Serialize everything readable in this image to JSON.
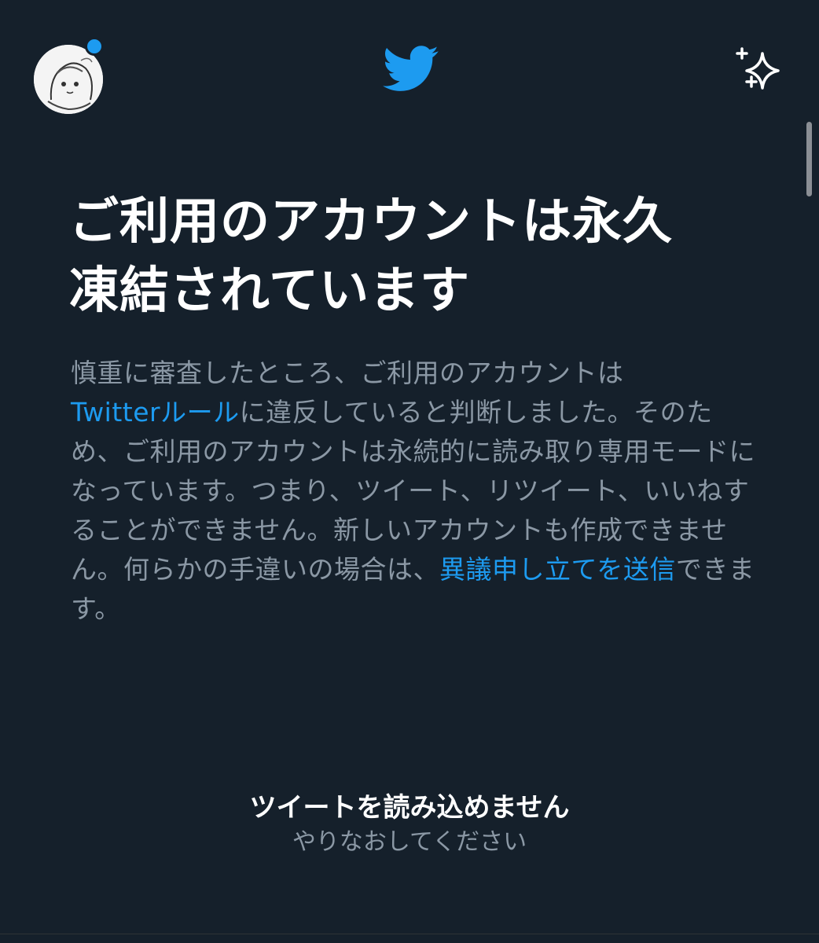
{
  "header": {
    "avatar_icon": "profile-avatar",
    "logo_icon": "twitter-bird-icon",
    "sparkle_icon": "sparkle-icon",
    "accent_color": "#1d9bf0"
  },
  "notice": {
    "headline_line1": "ご利用のアカウントは永久",
    "headline_line2": "凍結されています",
    "body_part1": "慎重に審査したところ、ご利用のアカウントは",
    "rules_link": "Twitterルール",
    "body_part2": "に違反していると判断しました。そのため、ご利用のアカウントは永続的に読み取り専用モードになっています。つまり、ツイート、リツイート、いいねすることができません。新しいアカウントも作成できません。何らかの手違いの場合は、",
    "appeal_link": "異議申し立てを送信",
    "body_part3": "できます。"
  },
  "error": {
    "title": "ツイートを読み込めません",
    "retry": "やりなおしてください"
  },
  "colors": {
    "background": "#15202b",
    "secondary_text": "#8b98a5",
    "link": "#1d9bf0"
  }
}
